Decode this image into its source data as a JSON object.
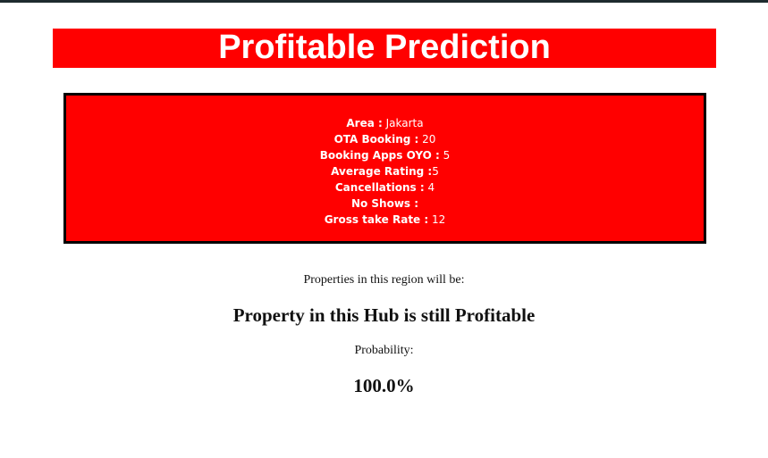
{
  "page": {
    "title": "Profitable Prediction"
  },
  "info": {
    "rows": [
      {
        "label": "Area :",
        "value": " Jakarta"
      },
      {
        "label": "OTA Booking :",
        "value": " 20"
      },
      {
        "label": "Booking Apps OYO :",
        "value": " 5"
      },
      {
        "label": "Average Rating :",
        "value": "5"
      },
      {
        "label": "Cancellations :",
        "value": " 4"
      },
      {
        "label": "No Shows :",
        "value": ""
      },
      {
        "label": "Gross take Rate :",
        "value": " 12"
      }
    ]
  },
  "result": {
    "intro": "Properties in this region will be:",
    "verdict": "Property in this Hub is still Profitable",
    "probability_label": "Probability:",
    "probability_value": "100.0%"
  },
  "colors": {
    "accent": "#ff0000",
    "text_on_accent": "#ffffff",
    "border": "#000000"
  }
}
